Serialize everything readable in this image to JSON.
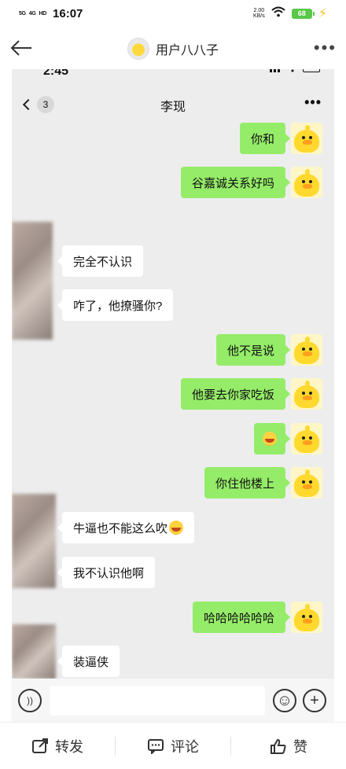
{
  "status_bar": {
    "signal1": "5G",
    "signal2": "4G",
    "hd": "HD",
    "time": "16:07",
    "net_speed_value": "2.00",
    "net_speed_unit": "KB/s",
    "battery": "68"
  },
  "header": {
    "title": "用户八八子",
    "more": "•••"
  },
  "screenshot": {
    "time": "2:45",
    "chat_title": "李现",
    "unread_count": "3",
    "more": "•••",
    "messages": [
      {
        "from": "me",
        "text": "你和"
      },
      {
        "from": "me",
        "text": "谷嘉诚关系好吗"
      },
      {
        "from": "them",
        "text": "完全不认识"
      },
      {
        "from": "them",
        "text": "咋了，他撩骚你?"
      },
      {
        "from": "me",
        "text": "他不是说"
      },
      {
        "from": "me",
        "text": "他要去你家吃饭"
      },
      {
        "from": "me",
        "text": "",
        "emoji": "laugh-cry"
      },
      {
        "from": "me",
        "text": "你住他楼上"
      },
      {
        "from": "them",
        "text": "牛逼也不能这么吹"
      },
      {
        "from": "them",
        "text": "我不认识他啊"
      },
      {
        "from": "me",
        "text": "哈哈哈哈哈哈"
      },
      {
        "from": "them",
        "text": "装逼侠"
      }
    ]
  },
  "footer": {
    "repost": "转发",
    "comment": "评论",
    "like": "赞"
  },
  "colors": {
    "my_bubble": "#95ec69",
    "their_bubble": "#ffffff",
    "chat_bg": "#ededed"
  }
}
